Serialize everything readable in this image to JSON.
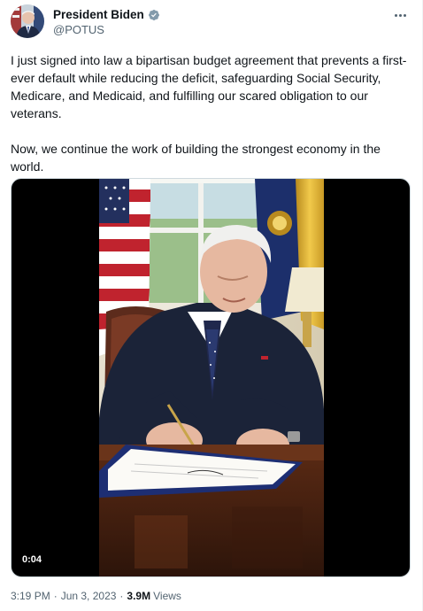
{
  "tweet": {
    "author_name": "President Biden",
    "author_handle": "@POTUS",
    "verified": true,
    "body": [
      "I just signed into law a bipartisan budget agreement that prevents a first-ever default while reducing the deficit, safeguarding Social Security, Medicare, and Medicaid, and fulfilling our scared obligation to our veterans.",
      "Now, we continue the work of building the strongest economy in the world."
    ],
    "media": {
      "type": "video",
      "duration": "0:04"
    },
    "time": "3:19 PM",
    "date": "Jun 3, 2023",
    "views_count": "3.9M",
    "views_label": "Views"
  },
  "colors": {
    "text_primary": "#0f1419",
    "text_secondary": "#536471",
    "verified_badge": "#829aab",
    "border": "#cfd9de"
  },
  "icons": {
    "verified": "verified-badge-icon",
    "more": "more-horizontal-icon"
  }
}
